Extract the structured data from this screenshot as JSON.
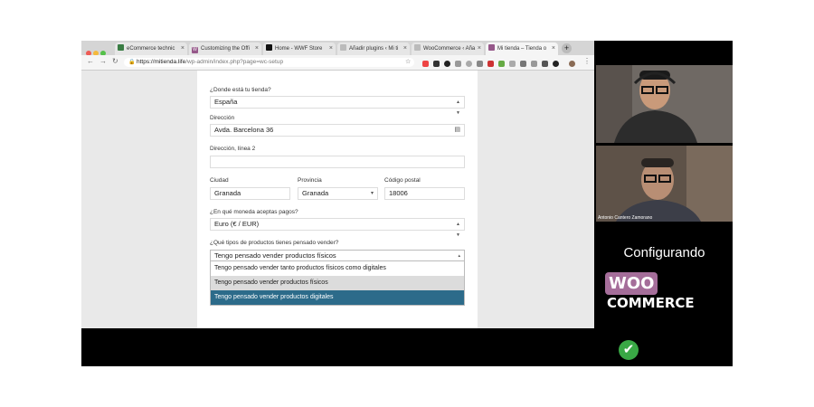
{
  "browser": {
    "tabs": [
      {
        "label": "eCommerce technic",
        "icon": "woo-icon"
      },
      {
        "label": "Customizing the Offi",
        "icon": "woo-icon"
      },
      {
        "label": "Home - WWF Store",
        "icon": "panda-icon"
      },
      {
        "label": "Añadir plugins ‹ Mi ti",
        "icon": "doc-icon"
      },
      {
        "label": "WooCommerce ‹ Aña",
        "icon": "doc-icon"
      },
      {
        "label": "Mi tienda – Tienda o",
        "icon": "woo-icon"
      }
    ],
    "url_host": "https://mitienda.life",
    "url_path": "/wp-admin/index.php?page=wc-setup"
  },
  "form": {
    "store_location_label": "¿Donde está tu tienda?",
    "store_location_value": "España",
    "address_label": "Dirección",
    "address_value": "Avda. Barcelona 36",
    "address2_label": "Dirección, línea 2",
    "address2_value": "",
    "city_label": "Ciudad",
    "city_value": "Granada",
    "province_label": "Provincia",
    "province_value": "Granada",
    "postcode_label": "Código postal",
    "postcode_value": "18006",
    "currency_label": "¿En qué moneda aceptas pagos?",
    "currency_value": "Euro (€ / EUR)",
    "product_type_label": "¿Qué tipos de productos tienes pensado vender?",
    "product_type_value": "Tengo pensado vender productos físicos",
    "product_type_options": [
      "Tengo pensado vender tanto productos físicos como digitales",
      "Tengo pensado vender productos físicos",
      "Tengo pensado vender productos digitales"
    ]
  },
  "webcam": {
    "participant_name": "Antonio Cantero Zamorano"
  },
  "overlay": {
    "configuring_text": "Configurando",
    "logo_woo": "WOO",
    "logo_commerce": "COMMERCE"
  },
  "colors": {
    "selected_option": "#2c6b8a",
    "woo_purple": "#a56e9a",
    "check_green": "#39a845"
  }
}
